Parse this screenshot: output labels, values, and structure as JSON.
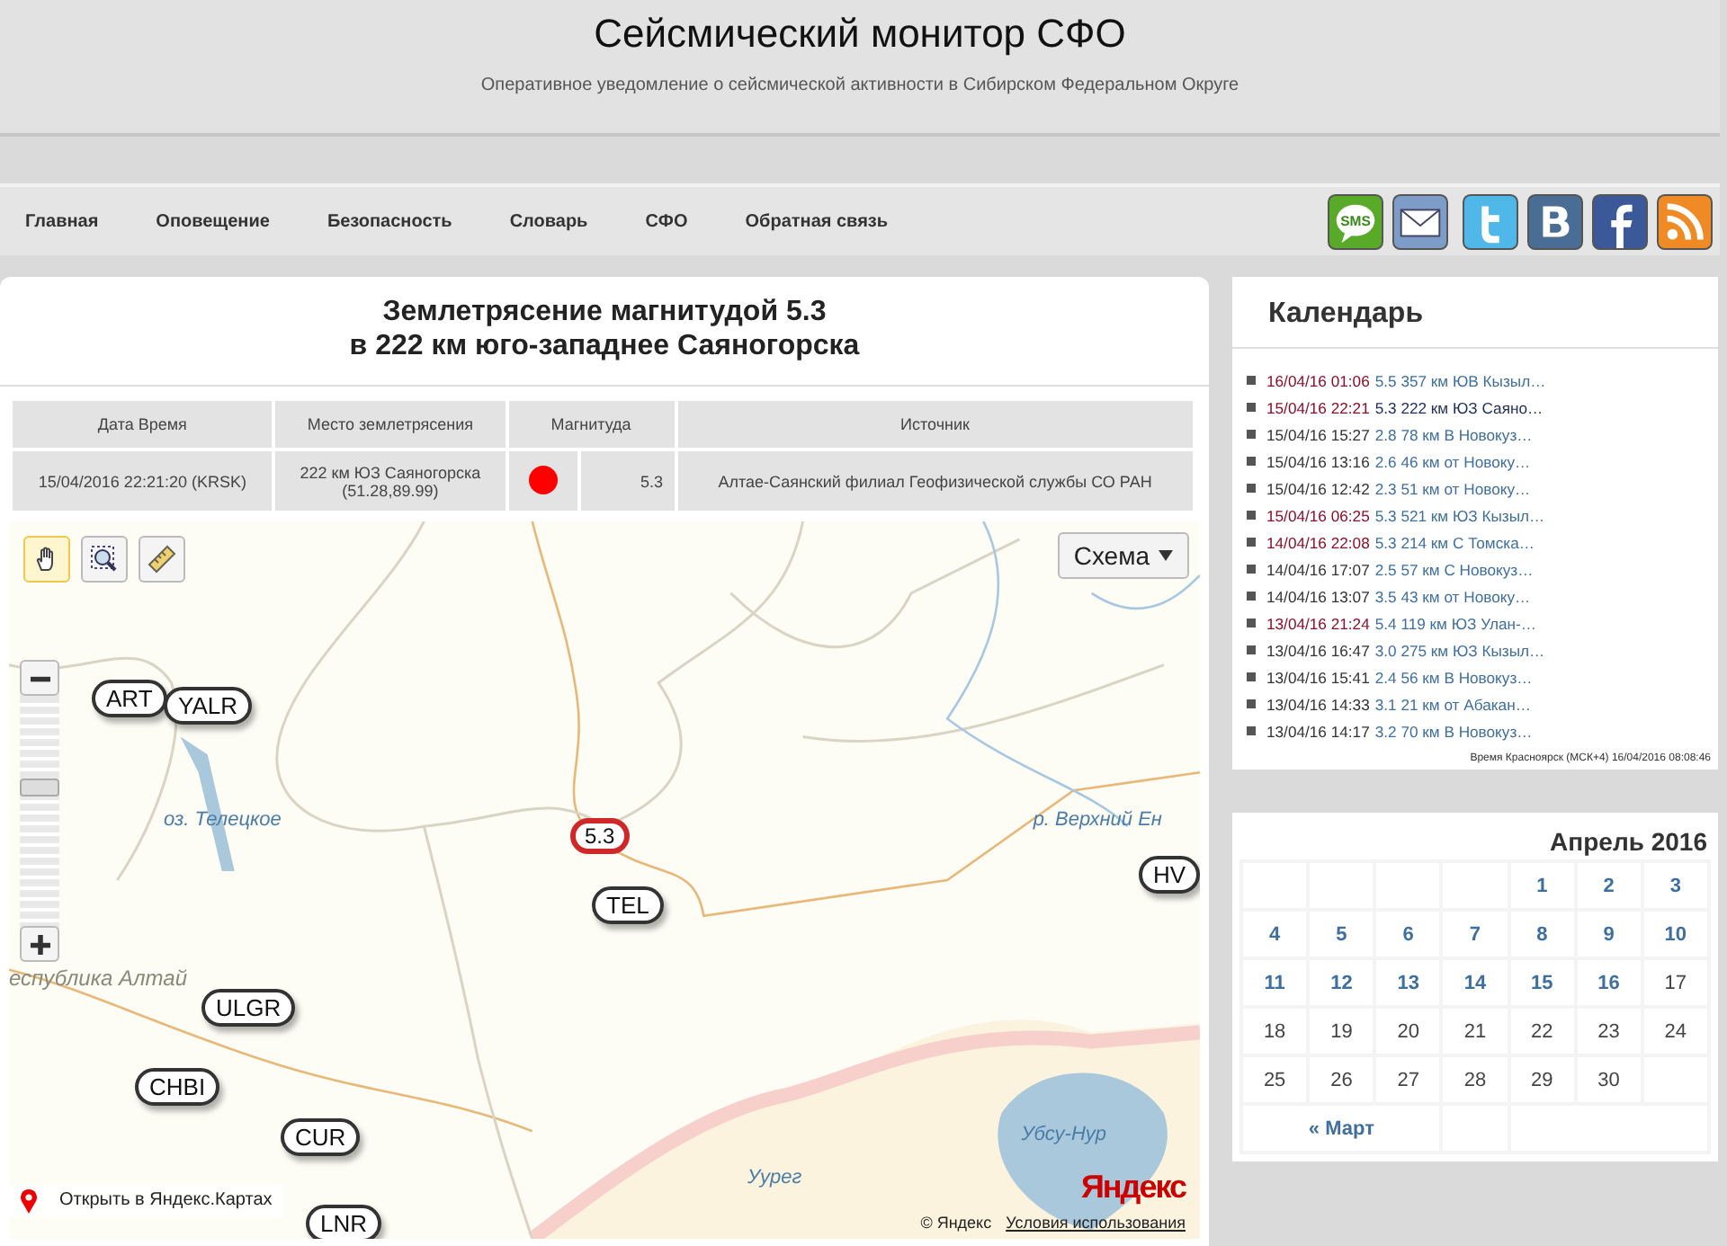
{
  "header": {
    "title": "Сейсмический монитор СФО",
    "subtitle": "Оперативное уведомление о сейсмической активности в Сибирском Федеральном Округе"
  },
  "nav": [
    "Главная",
    "Оповещение",
    "Безопасность",
    "Словарь",
    "СФО",
    "Обратная связь"
  ],
  "social": [
    {
      "kind": "sms",
      "label": "SMS",
      "color": "#5aaa2a"
    },
    {
      "kind": "mail",
      "color": "#7d9cc8"
    },
    {
      "kind": "twitter",
      "color": "#4fb8e8"
    },
    {
      "kind": "vk",
      "color": "#4a6d96"
    },
    {
      "kind": "facebook",
      "color": "#3b5998"
    },
    {
      "kind": "rss",
      "color": "#f08a24"
    }
  ],
  "event": {
    "title": "Землетрясение магнитудой 5.3",
    "subtitle": "в 222 км юго-западнее Саяногорска",
    "table": {
      "columns": [
        "Дата Время",
        "Место землетрясения",
        "Магнитуда",
        "Источник"
      ],
      "row": {
        "datetime": "15/04/2016 22:21:20 (KRSK)",
        "place": "222 км ЮЗ Саяногорска",
        "coords": "(51.28,89.99)",
        "color": "#ff0000",
        "magnitude": "5.3",
        "source": "Алтае-Саянский филиал Геофизической службы СО РАН"
      }
    }
  },
  "map": {
    "tools": [
      {
        "kind": "hand",
        "selected": true
      },
      {
        "kind": "zoom",
        "selected": false
      },
      {
        "kind": "ruler",
        "selected": false
      }
    ],
    "layer_button": "Схема",
    "zoom": {
      "level": 0.6
    },
    "labels": [
      {
        "kind": "water",
        "text": "оз. Телецкое"
      },
      {
        "kind": "water",
        "text": "р. Верхний Ен"
      },
      {
        "kind": "region",
        "text": "еспублика Алтай"
      },
      {
        "kind": "water",
        "text": "Убсу-Нур"
      },
      {
        "kind": "water",
        "text": "Уурег"
      }
    ],
    "stations": [
      "ART",
      "YALR",
      "TEL",
      "HV",
      "ULGR",
      "CHBI",
      "CUR",
      "LNR"
    ],
    "quake": "5.3",
    "open_link": "Открыть в Яндекс.Картах",
    "copyright": "© Яндекс",
    "terms": "Условия использования",
    "logo": "Яндекс"
  },
  "calendar": {
    "title": "Календарь",
    "events": [
      {
        "date": "16/04/16 01:06",
        "text": "5.5 357 км ЮВ Кызыл…",
        "strong": true,
        "current": false
      },
      {
        "date": "15/04/16 22:21",
        "text": "5.3 222 км ЮЗ Саяно…",
        "strong": true,
        "current": true
      },
      {
        "date": "15/04/16 15:27",
        "text": "2.8 78 км В Новокуз…",
        "strong": false,
        "current": false
      },
      {
        "date": "15/04/16 13:16",
        "text": "2.6 46 км от Новоку…",
        "strong": false,
        "current": false
      },
      {
        "date": "15/04/16 12:42",
        "text": "2.3 51 км от Новоку…",
        "strong": false,
        "current": false
      },
      {
        "date": "15/04/16 06:25",
        "text": "5.3 521 км ЮЗ Кызыл…",
        "strong": true,
        "current": false
      },
      {
        "date": "14/04/16 22:08",
        "text": "5.3 214 км С Томска…",
        "strong": true,
        "current": false
      },
      {
        "date": "14/04/16 17:07",
        "text": "2.5 57 км С Новокуз…",
        "strong": false,
        "current": false
      },
      {
        "date": "14/04/16 13:07",
        "text": "3.5 43 км от Новоку…",
        "strong": false,
        "current": false
      },
      {
        "date": "13/04/16 21:24",
        "text": "5.4 119 км ЮЗ Улан-…",
        "strong": true,
        "current": false
      },
      {
        "date": "13/04/16 16:47",
        "text": "3.0 275 км ЮЗ Кызыл…",
        "strong": false,
        "current": false
      },
      {
        "date": "13/04/16 15:41",
        "text": "2.4 56 км В Новокуз…",
        "strong": false,
        "current": false
      },
      {
        "date": "13/04/16 14:33",
        "text": "3.1 21 км от Абакан…",
        "strong": false,
        "current": false
      },
      {
        "date": "13/04/16 14:17",
        "text": "3.2 70 км В Новокуз…",
        "strong": false,
        "current": false
      }
    ],
    "time_note": "Время Красноярск (МСК+4) 16/04/2016 08:08:46"
  },
  "month": {
    "title": "Апрель 2016",
    "weeks": [
      [
        {
          "day": "1",
          "linked": true
        },
        {
          "day": "2",
          "linked": true
        },
        {
          "day": "3",
          "linked": true
        }
      ],
      [
        {
          "day": "4",
          "linked": true
        },
        {
          "day": "5",
          "linked": true
        },
        {
          "day": "6",
          "linked": true
        },
        {
          "day": "7",
          "linked": true
        },
        {
          "day": "8",
          "linked": true
        },
        {
          "day": "9",
          "linked": true
        },
        {
          "day": "10",
          "linked": true
        }
      ],
      [
        {
          "day": "11",
          "linked": true
        },
        {
          "day": "12",
          "linked": true
        },
        {
          "day": "13",
          "linked": true
        },
        {
          "day": "14",
          "linked": true
        },
        {
          "day": "15",
          "linked": true
        },
        {
          "day": "16",
          "linked": true
        },
        {
          "day": "17",
          "linked": false
        }
      ],
      [
        {
          "day": "18",
          "linked": false
        },
        {
          "day": "19",
          "linked": false
        },
        {
          "day": "20",
          "linked": false
        },
        {
          "day": "21",
          "linked": false
        },
        {
          "day": "22",
          "linked": false
        },
        {
          "day": "23",
          "linked": false
        },
        {
          "day": "24",
          "linked": false
        }
      ],
      [
        {
          "day": "25",
          "linked": false
        },
        {
          "day": "26",
          "linked": false
        },
        {
          "day": "27",
          "linked": false
        },
        {
          "day": "28",
          "linked": false
        },
        {
          "day": "29",
          "linked": false
        },
        {
          "day": "30",
          "linked": false
        }
      ]
    ],
    "prev": "« Март"
  }
}
